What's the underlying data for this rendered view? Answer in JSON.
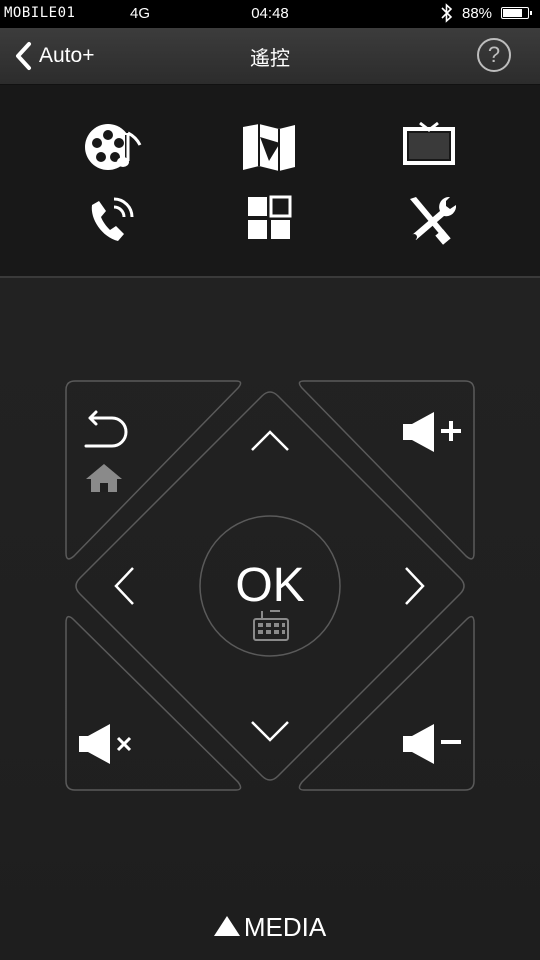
{
  "status_bar": {
    "carrier": "MOBILE01",
    "network": "4G",
    "time": "04:48",
    "battery": "88%",
    "battery_level": 0.88
  },
  "nav": {
    "back_label": "Auto+",
    "title": "遙控",
    "help_symbol": "?"
  },
  "menu": {
    "items": [
      {
        "icon": "film-music-icon"
      },
      {
        "icon": "map-icon"
      },
      {
        "icon": "tv-icon"
      },
      {
        "icon": "phone-call-icon"
      },
      {
        "icon": "grid-apps-icon"
      },
      {
        "icon": "tools-icon"
      }
    ]
  },
  "remote": {
    "ok_label": "OK",
    "media_label": "MEDIA"
  },
  "colors": {
    "background": "#1f1f1f",
    "outline": "#5a5a5a",
    "icon": "#ffffff"
  }
}
